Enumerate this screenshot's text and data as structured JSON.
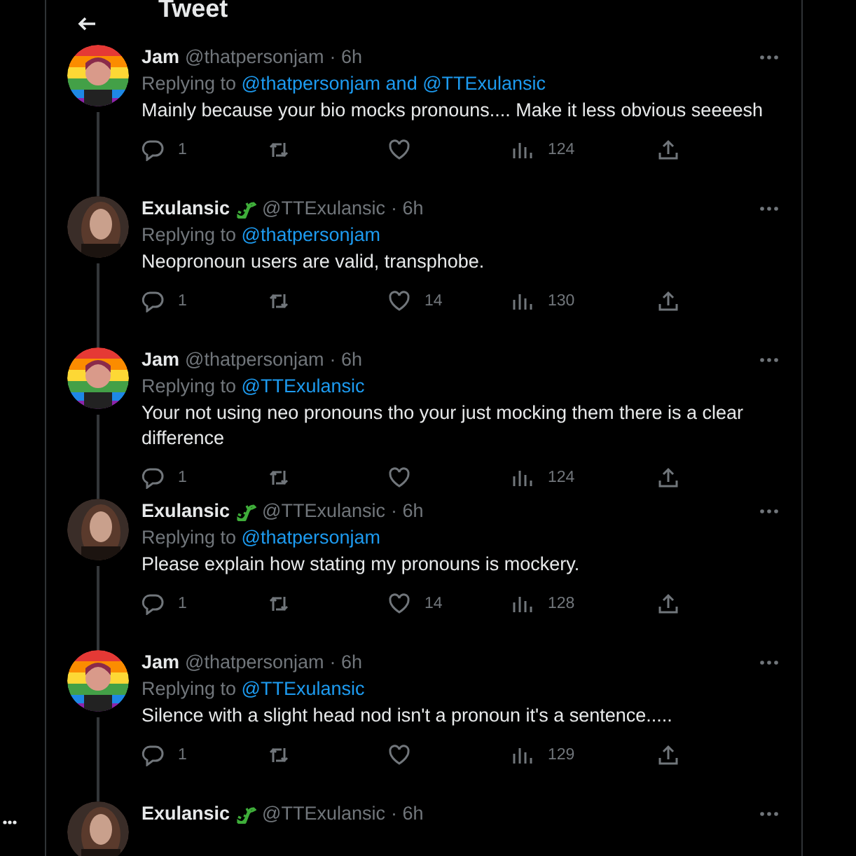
{
  "header": {
    "title": "Tweet"
  },
  "tweets": [
    {
      "name": "Jam",
      "emoji": false,
      "handle": "@thatpersonjam",
      "time": "· 6h",
      "kind": "rainbow",
      "replying_prefix": "Replying to",
      "replying_to": "@thatpersonjam and @TTExulansic",
      "text": "Mainly because your bio mocks pronouns.... Make it less obvious seeeesh",
      "replies": "1",
      "views": "124"
    },
    {
      "name": "Exulansic",
      "emoji": true,
      "handle": "@TTExulansic",
      "time": "· 6h",
      "kind": "dark",
      "replying_prefix": "Replying to",
      "replying_to": "@thatpersonjam",
      "text": "Neopronoun users are valid, transphobe.",
      "replies": "1",
      "likes": "14",
      "views": "130"
    },
    {
      "name": "Jam",
      "emoji": false,
      "handle": "@thatpersonjam",
      "time": "· 6h",
      "kind": "rainbow",
      "replying_prefix": "Replying to",
      "replying_to": "@TTExulansic",
      "text": "Your not using neo pronouns tho your just mocking them there is a clear difference",
      "replies": "1",
      "views": "124"
    },
    {
      "name": "Exulansic",
      "emoji": true,
      "handle": "@TTExulansic",
      "time": "· 6h",
      "kind": "dark",
      "replying_prefix": "Replying to",
      "replying_to": "@thatpersonjam",
      "text": "Please explain how stating my pronouns is mockery.",
      "replies": "1",
      "likes": "14",
      "views": "128"
    },
    {
      "name": "Jam",
      "emoji": false,
      "handle": "@thatpersonjam",
      "time": "· 6h",
      "kind": "rainbow",
      "replying_prefix": "Replying to",
      "replying_to": "@TTExulansic",
      "text": "Silence with a slight head nod isn't a pronoun it's a sentence.....",
      "replies": "1",
      "views": "129"
    },
    {
      "name": "Exulansic",
      "emoji": true,
      "handle": "@TTExulansic",
      "time": "· 6h",
      "kind": "dark"
    }
  ]
}
